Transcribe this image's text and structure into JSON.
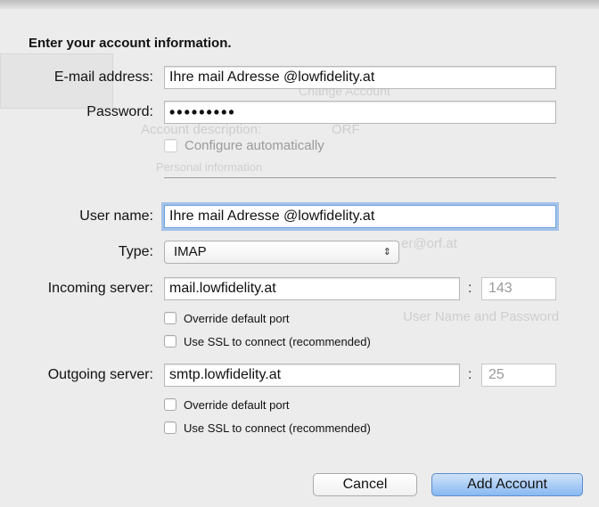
{
  "form": {
    "heading": "Enter your account information.",
    "email": {
      "label": "E-mail address:",
      "value": "Ihre mail Adresse @lowfidelity.at"
    },
    "password": {
      "label": "Password:",
      "value": "•••••••••"
    },
    "configure_auto": {
      "label": "Configure automatically"
    },
    "username": {
      "label": "User name:",
      "value": "Ihre mail Adresse @lowfidelity.at"
    },
    "type": {
      "label": "Type:",
      "value": "IMAP"
    },
    "incoming": {
      "label": "Incoming server:",
      "value": "mail.lowfidelity.at",
      "port": "143",
      "override_label": "Override default port",
      "ssl_label": "Use SSL to connect (recommended)"
    },
    "outgoing": {
      "label": "Outgoing server:",
      "value": "smtp.lowfidelity.at",
      "port": "25",
      "override_label": "Override default port",
      "ssl_label": "Use SSL to connect (recommended)"
    }
  },
  "buttons": {
    "cancel": "Cancel",
    "add_account": "Add Account"
  },
  "background": {
    "personal_information": "Personal information",
    "account_description": "Account description:",
    "account_description_value": "ORF",
    "change_account_text": "Change Account",
    "user_name_and_password": "User Name and Password",
    "email_suffix": "er@orf.at"
  },
  "icons": {
    "checkbox": "checkbox-icon",
    "select_arrows": "updown-arrows-icon"
  }
}
